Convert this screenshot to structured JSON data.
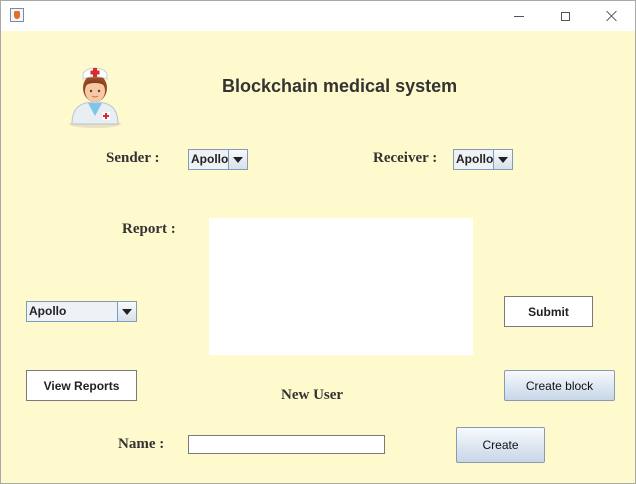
{
  "window": {
    "title": ""
  },
  "header": {
    "title": "Blockchain medical system",
    "avatar_icon": "nurse-icon"
  },
  "form": {
    "sender_label": "Sender :",
    "sender_value": "Apollo",
    "receiver_label": "Receiver :",
    "receiver_value": "Apollo",
    "report_label": "Report :",
    "report_value": "",
    "hospital_value": "Apollo",
    "submit_label": "Submit",
    "view_reports_label": "View Reports",
    "create_block_label": "Create block",
    "new_user_label": "New User",
    "name_label": "Name :",
    "name_value": "",
    "create_label": "Create"
  },
  "colors": {
    "background": "#fffacd",
    "titlebar": "#ffffff"
  }
}
